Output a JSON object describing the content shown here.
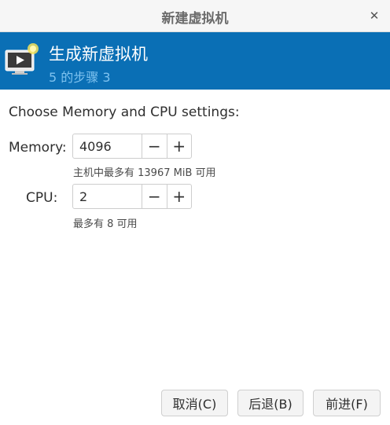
{
  "window": {
    "title": "新建虚拟机"
  },
  "banner": {
    "title": "生成新虚拟机",
    "step": "5 的步骤 3",
    "icon": "new-vm-monitor-icon"
  },
  "form": {
    "prompt": "Choose Memory and CPU settings:",
    "memory": {
      "label": "Memory:",
      "value": "4096",
      "hint": "主机中最多有 13967 MiB 可用"
    },
    "cpu": {
      "label": "CPU:",
      "value": "2",
      "hint": "最多有 8 可用"
    }
  },
  "buttons": {
    "cancel": "取消(C)",
    "back": "后退(B)",
    "forward": "前进(F)"
  },
  "colors": {
    "banner": "#0a6fb5",
    "banner_step": "#7ec2ef"
  }
}
